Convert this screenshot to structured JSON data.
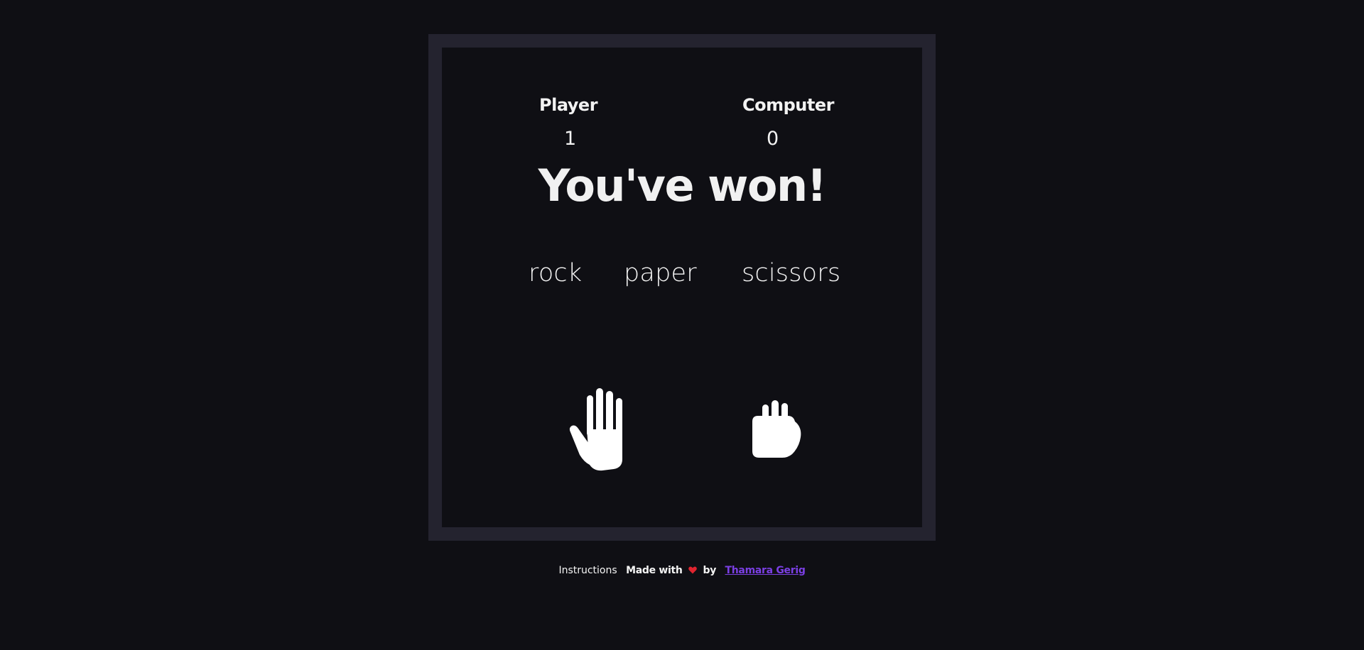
{
  "scoreboard": {
    "player_label": "Player",
    "computer_label": "Computer",
    "player_score": "1",
    "computer_score": "0"
  },
  "result_text": "You've won!",
  "choices": [
    {
      "label": "rock"
    },
    {
      "label": "paper"
    },
    {
      "label": "scissors"
    }
  ],
  "hands": {
    "player": "paper-hand-icon",
    "computer": "rock-hand-icon"
  },
  "footer": {
    "instructions_label": "Instructions",
    "made_with": "Made with",
    "by": "by",
    "author": "Thamara Gerig",
    "heart_color": "#e0242f",
    "link_color": "#7b3fe4"
  },
  "colors": {
    "background": "#0f0f14",
    "frame": "#24232f",
    "text": "#f2f2f2"
  }
}
